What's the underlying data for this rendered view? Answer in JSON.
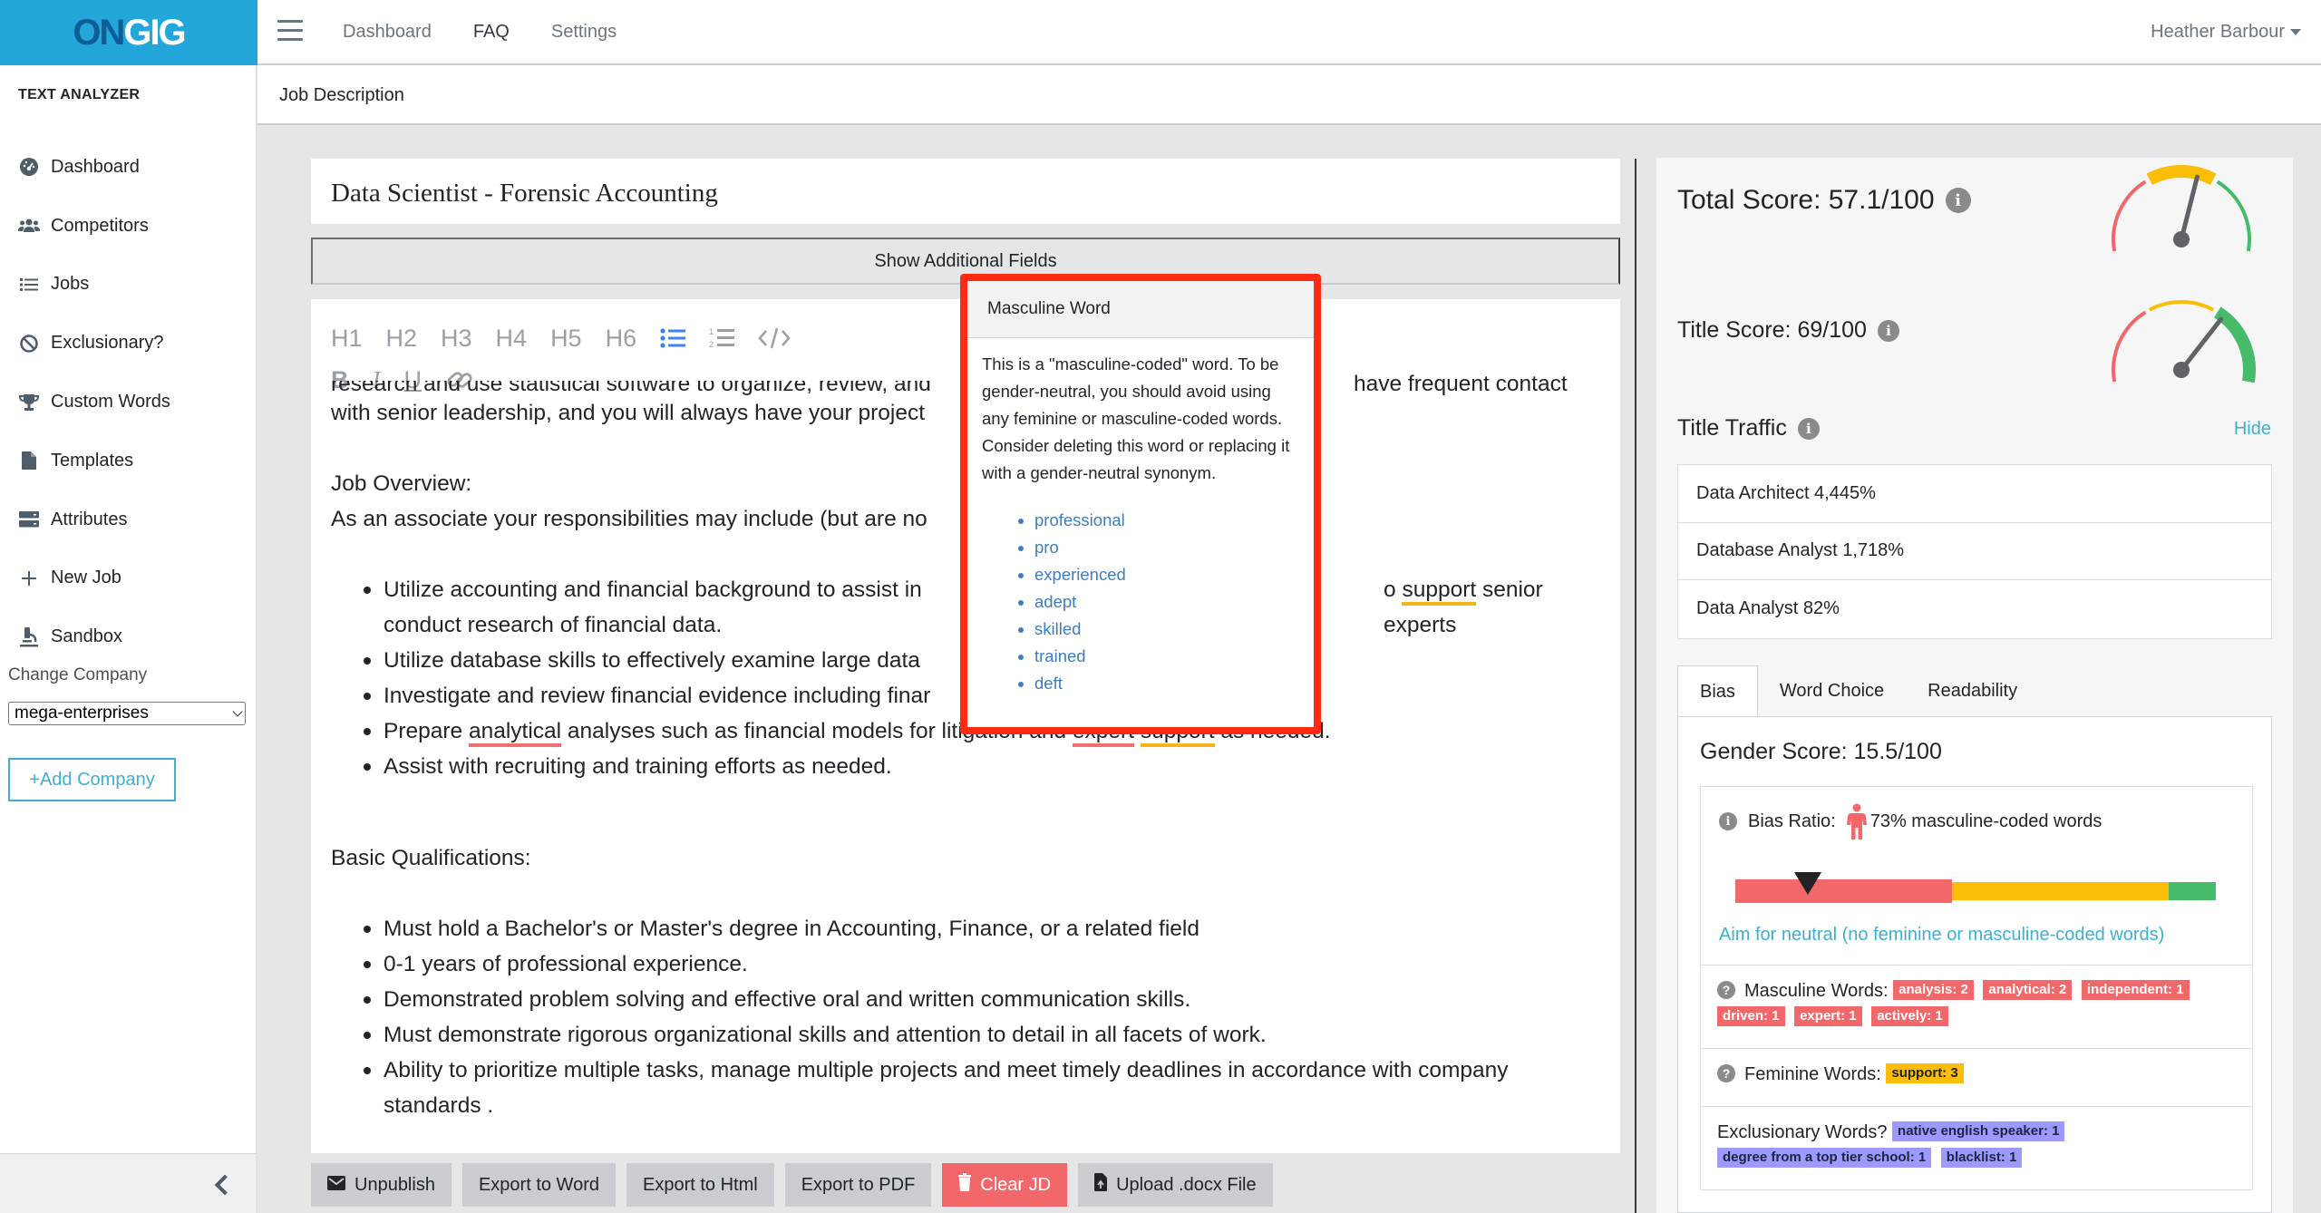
{
  "header": {
    "logo_on": "ON",
    "logo_gig": "GIG",
    "nav": [
      "Dashboard",
      "FAQ",
      "Settings"
    ],
    "active_nav": "FAQ",
    "user_name": "Heather Barbour"
  },
  "subheader": {
    "title": "Job Description"
  },
  "sidebar": {
    "title": "TEXT ANALYZER",
    "items": [
      {
        "label": "Dashboard",
        "icon": "tachometer-icon"
      },
      {
        "label": "Competitors",
        "icon": "users-icon"
      },
      {
        "label": "Jobs",
        "icon": "list-icon"
      },
      {
        "label": "Exclusionary?",
        "icon": "ban-icon"
      },
      {
        "label": "Custom Words",
        "icon": "trophy-icon"
      },
      {
        "label": "Templates",
        "icon": "file-icon"
      },
      {
        "label": "Attributes",
        "icon": "server-icon"
      },
      {
        "label": "New Job",
        "icon": "plus-icon"
      },
      {
        "label": "Sandbox",
        "icon": "microscope-icon"
      }
    ],
    "change_company_label": "Change Company",
    "company_selected": "mega-enterprises",
    "add_company_label": "+Add Company"
  },
  "editor": {
    "job_title": "Data Scientist - Forensic Accounting",
    "additional_fields_label": "Show Additional Fields",
    "toolbar": {
      "headings": [
        "H1",
        "H2",
        "H3",
        "H4",
        "H5",
        "H6"
      ],
      "bold": "B",
      "italic": "I",
      "underline": "U"
    },
    "clipped_line_left": "research and use statistical software to organize, review, and",
    "clipped_line_right": "have frequent contact",
    "line_with_senior": "with senior leadership, and you will always have your project",
    "job_overview_heading": "Job Overview:",
    "job_overview_intro": "As an associate your responsibilities may include (but are no",
    "responsibilities": {
      "r1_a": "Utilize accounting and financial background to assist in",
      "r1_b": "o ",
      "r1_fword": "support",
      "r1_c": " senior experts",
      "r1_d": "conduct research of financial data.",
      "r2": "Utilize database skills to effectively examine large data",
      "r3": "Investigate and review financial evidence including finar",
      "r4_a": "Prepare ",
      "r4_mword1": "analytical",
      "r4_b": " analyses such as financial models for litigation and ",
      "r4_mword2": "expert",
      "r4_c": " ",
      "r4_fword": "support",
      "r4_d": " as needed.",
      "r5": "Assist with recruiting and training efforts as needed."
    },
    "basic_heading": "Basic Qualifications:",
    "qualifications": [
      "Must hold a Bachelor's or Master's degree in Accounting, Finance, or a related field",
      "0-1 years of professional experience.",
      "Demonstrated problem solving and effective oral and written communication skills.",
      "Must demonstrate rigorous organizational skills and attention to detail in all facets of work.",
      "Ability to prioritize multiple tasks, manage multiple projects and meet timely deadlines in accordance with company standards ."
    ]
  },
  "popup": {
    "title": "Masculine Word",
    "body": "This is a \"masculine-coded\" word. To be gender-neutral, you should avoid using any feminine or masculine-coded words. Consider deleting this word or replacing it with a gender-neutral synonym.",
    "synonyms": [
      "professional",
      "pro",
      "experienced",
      "adept",
      "skilled",
      "trained",
      "deft"
    ]
  },
  "buttons": {
    "unpublish": "Unpublish",
    "export_word": "Export to Word",
    "export_html": "Export to Html",
    "export_pdf": "Export to PDF",
    "clear_jd": "Clear JD",
    "upload_docx": "Upload .docx File"
  },
  "scores": {
    "total_label": "Total Score: 57.1/100",
    "total_value": 57.1,
    "title_label": "Title Score: 69/100",
    "title_value": 69,
    "max": 100
  },
  "title_traffic": {
    "label": "Title Traffic",
    "hide_label": "Hide",
    "items": [
      "Data Architect 4,445%",
      "Database Analyst 1,718%",
      "Data Analyst 82%"
    ]
  },
  "tabs": [
    "Bias",
    "Word Choice",
    "Readability"
  ],
  "active_tab": "Bias",
  "bias": {
    "gender_score": "Gender Score: 15.5/100",
    "bias_ratio_label": "Bias Ratio:",
    "bias_ratio_text": "73% masculine-coded words",
    "bias_ratio_value": 0.73,
    "marker_position": 0.15,
    "aim_text": "Aim for neutral (no feminine or masculine-coded words)",
    "masculine_label": "Masculine Words:",
    "masculine_words": [
      "analysis: 2",
      "analytical: 2",
      "independent: 1",
      "driven: 1",
      "expert: 1",
      "actively: 1"
    ],
    "feminine_label": "Feminine Words:",
    "feminine_words": [
      "support: 3"
    ],
    "exclusionary_label": "Exclusionary Words?",
    "exclusionary_words": [
      "native english speaker: 1",
      "degree from a top tier school: 1",
      "blacklist: 1"
    ]
  },
  "colors": {
    "brand": "#23a7da",
    "masculine": "#f2686a",
    "feminine": "#fbbd08",
    "neutral": "#48bb6b",
    "exclusionary": "#9e99ff",
    "link": "#3fafd0",
    "highlight_box": "#ff2a12"
  }
}
